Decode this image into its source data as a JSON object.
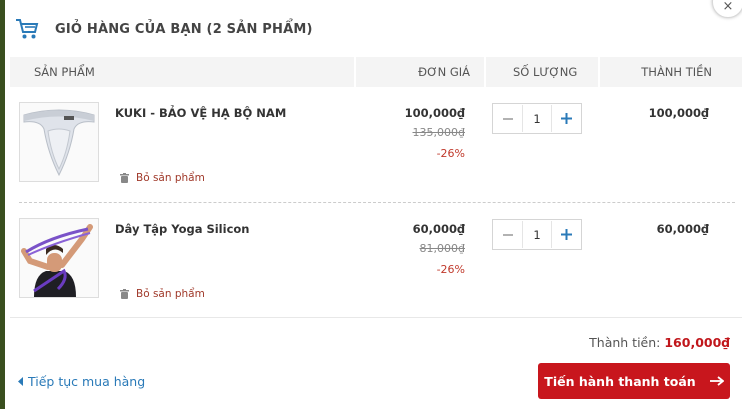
{
  "header": {
    "title": "GIỎ HÀNG CỦA BẠN (2 SẢN PHẨM)",
    "icon": "cart-icon"
  },
  "close": {
    "symbol": "×"
  },
  "columns": {
    "product": "SẢN PHẨM",
    "unit_price": "ĐƠN GIÁ",
    "quantity": "SỐ LƯỢNG",
    "total": "THÀNH TIỀN"
  },
  "items": [
    {
      "name": "KUKI - BẢO VỆ HẠ BỘ NAM",
      "price": "100,000₫",
      "old_price": "135,000₫",
      "discount": "-26%",
      "quantity": "1",
      "line_total": "100,000₫",
      "remove_label": "Bỏ sản phẩm"
    },
    {
      "name": "Dây Tập Yoga Silicon",
      "price": "60,000₫",
      "old_price": "81,000₫",
      "discount": "-26%",
      "quantity": "1",
      "line_total": "60,000₫",
      "remove_label": "Bỏ sản phẩm"
    }
  ],
  "summary": {
    "label": "Thành tiền:",
    "value": "160,000₫"
  },
  "footer": {
    "continue_label": "Tiếp tục mua hàng",
    "checkout_label": "Tiến hành thanh toán"
  },
  "colors": {
    "accent": "#c8161d",
    "link": "#2a7ab8",
    "icon_blue": "#2a7ab8",
    "header_bg": "#f4f4f4"
  }
}
